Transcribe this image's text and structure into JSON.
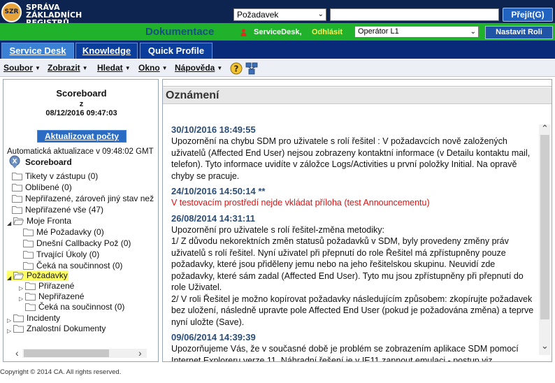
{
  "header": {
    "logo_text_line1": "SPRÁVA ZÁKLADNÍCH",
    "logo_text_line2": "REGISTRŮ",
    "logo_badge": "SZR",
    "search_type": "Požadavek",
    "search_value": "",
    "go_button": "Přejít(G)"
  },
  "greenbar": {
    "doc_link": "Dokumentace",
    "user_name": "ServiceDesk,",
    "logout": "Odhlásit",
    "role": "Operátor L1",
    "set_role_button": "Nastavit Roli"
  },
  "tabs": [
    {
      "label": "Service Desk",
      "active": true
    },
    {
      "label": "Knowledge",
      "active": false
    },
    {
      "label": "Quick Profile",
      "active": false
    }
  ],
  "menu": [
    {
      "label": "Soubor"
    },
    {
      "label": "Zobrazit"
    },
    {
      "label": "Hledat"
    },
    {
      "label": "Okno"
    },
    {
      "label": "Nápověda"
    }
  ],
  "scoreboard": {
    "title": "Scoreboard",
    "sub_z": "z",
    "timestamp": "08/12/2016 09:47:03",
    "refresh_button": "Aktualizovat počty",
    "auto_refresh": "Automatická aktualizace v 09:48:02 GMT",
    "root": "Scoreboard",
    "items": [
      {
        "label": "Tikety v zástupu (0)"
      },
      {
        "label": "Oblíbené (0)"
      },
      {
        "label": "Nepřiřazené, zároveň jiný stav než"
      },
      {
        "label": "Nepřiřazené vše (47)"
      },
      {
        "label": "Moje Fronta"
      },
      {
        "label": "Mé Požadavky (0)"
      },
      {
        "label": "Dnešní Callbacky Pož (0)"
      },
      {
        "label": "Trvající Úkoly (0)"
      },
      {
        "label": "Čeká na součinnost (0)"
      },
      {
        "label": "Požadavky"
      },
      {
        "label": "Přiřazené"
      },
      {
        "label": "Nepřiřazené"
      },
      {
        "label": "Čeká na součinnost (0)"
      },
      {
        "label": "Incidenty"
      },
      {
        "label": "Znalostní Dokumenty"
      }
    ]
  },
  "announcements": {
    "title": "Oznámení",
    "items": [
      {
        "date": "30/10/2016 18:49:55",
        "body": "Upozornění na chybu SDM pro uživatele s rolí řešitel : V požadavcích nově založených uživatelů (Affected End User) nejsou zobrazeny kontaktní informace (v Detailu kontaktu mail, telefon). Tyto informace uvidíte v záložce Logs/Activities u první položky Initial. Na opravě chyby se pracuje.",
        "red": false
      },
      {
        "date": "24/10/2016 14:50:14 **",
        "body": "V testovacím prostředí nejde vkládat příloha (test Announcementu)",
        "red": true
      },
      {
        "date": "26/08/2014 14:31:11",
        "body": "Upozornění pro uživatele s rolí řešitel-změna metodiky:\n1/ Z důvodu nekorektních změn statusů požadavků v SDM, byly provedeny změny práv uživatelů s rolí řešitel. Nyní uživatel při přepnutí do role Řešitel má zpřístupněny pouze požadavky, které jsou přiděleny jemu nebo na jeho řešitelskou skupinu. Neuvidí zde požadavky, které sám zadal (Affected End User). Tyto mu jsou zpřístupněny při přepnutí do role Uživatel.\n2/ V roli Řešitel je možno kopírovat požadavky následujícím způsobem: zkopírujte požadavek bez uložení, následně upravte pole Affected End User (pokud je požadována změna) a teprve nyní uložte (Save).",
        "red": false
      },
      {
        "date": "09/06/2014 14:39:39",
        "body": "Upozorňujeme Vás, že v současné době je problém se zobrazením aplikace SDM pomocí Internet Exploreru verze 11. Náhradní řešení je v IE11 zapnout emulaci - postup viz. http://www.szrcr.cz/vyvojari/pristup-do-service-desk-managera . Na",
        "red": false
      }
    ]
  },
  "footer": "Copyright © 2014 CA. All rights reserved."
}
